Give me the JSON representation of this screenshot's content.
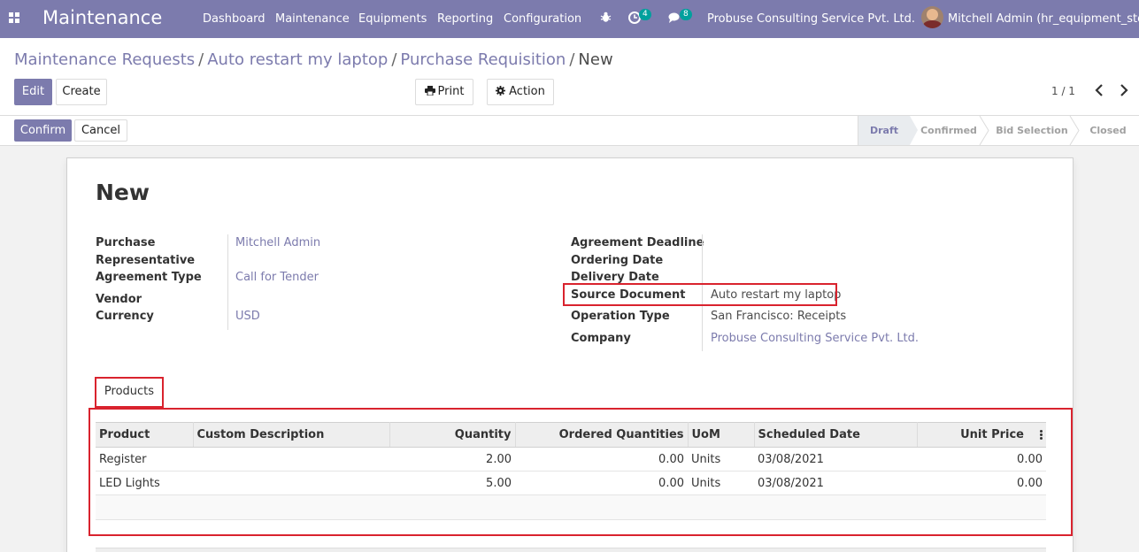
{
  "navbar": {
    "brand": "Maintenance",
    "menu": [
      "Dashboard",
      "Maintenance",
      "Equipments",
      "Reporting",
      "Configuration"
    ],
    "activity_count": "4",
    "messages_count": "8",
    "company": "Probuse Consulting Service Pvt. Ltd.",
    "user": "Mitchell Admin (hr_equipment_stock)",
    "color": "#7c7bad"
  },
  "breadcrumb": {
    "items": [
      "Maintenance Requests",
      "Auto restart my laptop",
      "Purchase Requisition"
    ],
    "current": "New",
    "separator": "/"
  },
  "toolbar": {
    "edit_label": "Edit",
    "create_label": "Create",
    "print_label": "Print",
    "action_label": "Action",
    "pager": "1 / 1"
  },
  "statusbar": {
    "confirm_label": "Confirm",
    "cancel_label": "Cancel",
    "stages": [
      "Draft",
      "Confirmed",
      "Bid Selection",
      "Closed"
    ],
    "current_stage": "Draft"
  },
  "form": {
    "title": "New",
    "left": {
      "purchase_rep_label_1": "Purchase",
      "purchase_rep_label_2": "Representative",
      "purchase_rep_value": "Mitchell Admin",
      "agreement_type_label": "Agreement Type",
      "agreement_type_value": "Call for Tender",
      "vendor_label": "Vendor",
      "currency_label": "Currency",
      "currency_value": "USD"
    },
    "right": {
      "agreement_deadline_label": "Agreement Deadline",
      "ordering_date_label": "Ordering Date",
      "delivery_date_label": "Delivery Date",
      "source_document_label": "Source Document",
      "source_document_value": "Auto restart my laptop",
      "operation_type_label": "Operation Type",
      "operation_type_value": "San Francisco: Receipts",
      "company_label": "Company",
      "company_value": "Probuse Consulting Service Pvt. Ltd."
    },
    "tab_label": "Products"
  },
  "products": {
    "columns": [
      "Product",
      "Custom Description",
      "Quantity",
      "Ordered Quantities",
      "UoM",
      "Scheduled Date",
      "Unit Price"
    ],
    "rows": [
      {
        "product": "Register",
        "description": "",
        "quantity": "2.00",
        "ordered": "0.00",
        "uom": "Units",
        "date": "03/08/2021",
        "price": "0.00"
      },
      {
        "product": "LED Lights",
        "description": "",
        "quantity": "5.00",
        "ordered": "0.00",
        "uom": "Units",
        "date": "03/08/2021",
        "price": "0.00"
      }
    ]
  },
  "highlight_color": "#d9232e"
}
